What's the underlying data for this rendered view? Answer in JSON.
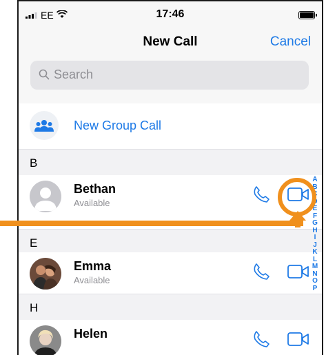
{
  "status_bar": {
    "carrier": "EE",
    "time": "17:46"
  },
  "header": {
    "title": "New Call",
    "cancel_label": "Cancel"
  },
  "search": {
    "placeholder": "Search"
  },
  "new_group_call": {
    "label": "New Group Call"
  },
  "sections": [
    {
      "letter": "B",
      "contacts": [
        {
          "name": "Bethan",
          "status": "Available"
        }
      ]
    },
    {
      "letter": "E",
      "contacts": [
        {
          "name": "Emma",
          "status": "Available"
        }
      ]
    },
    {
      "letter": "H",
      "contacts": [
        {
          "name": "Helen",
          "status": ""
        }
      ]
    }
  ],
  "alphabet_index": [
    "A",
    "B",
    "C",
    "D",
    "E",
    "F",
    "G",
    "H",
    "I",
    "J",
    "K",
    "L",
    "M",
    "N",
    "O",
    "P"
  ],
  "colors": {
    "accent": "#1e7ae6",
    "annotation": "#f0901d"
  },
  "icons": [
    "signal-icon",
    "wifi-icon",
    "battery-icon",
    "search-icon",
    "group-icon",
    "phone-icon",
    "video-icon"
  ]
}
